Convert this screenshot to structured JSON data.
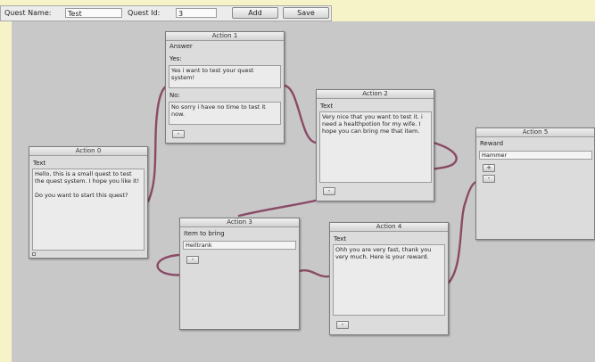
{
  "toolbar": {
    "quest_name_label": "Quest Name:",
    "quest_name_value": "Test",
    "quest_id_label": "Quest Id:",
    "quest_id_value": "3",
    "add_label": "Add",
    "save_label": "Save"
  },
  "colors": {
    "canvas": "#c8c8c8",
    "outer_background": "#f7f3c8",
    "connection": "#8a4a66"
  },
  "nodes": {
    "action0": {
      "title": "Action 0",
      "type_label": "Text",
      "text": "Hello, this is a small quest to test the quest system. I hope you like it!\n\nDo you want to start this quest?"
    },
    "action1": {
      "title": "Action 1",
      "type_label": "Answer",
      "yes_label": "Yes:",
      "yes_text": "Yes i want to test your quest system!",
      "no_label": "No:",
      "no_text": "No sorry i have no time to test it now.",
      "remove_label": "-"
    },
    "action2": {
      "title": "Action 2",
      "type_label": "Text",
      "text": "Very nice that you want to test it. i need a healthpotion for my wife. I hope you can bring me that item.",
      "remove_label": "-"
    },
    "action3": {
      "title": "Action 3",
      "type_label": "Item to bring",
      "item_value": "Heiltrank",
      "remove_label": "-"
    },
    "action4": {
      "title": "Action 4",
      "type_label": "Text",
      "text": "Ohh you are very fast, thank you very much. Here is your reward.",
      "remove_label": "-"
    },
    "action5": {
      "title": "Action 5",
      "type_label": "Reward",
      "reward_value": "Hammer",
      "add_label": "+",
      "remove_label": "-"
    }
  }
}
